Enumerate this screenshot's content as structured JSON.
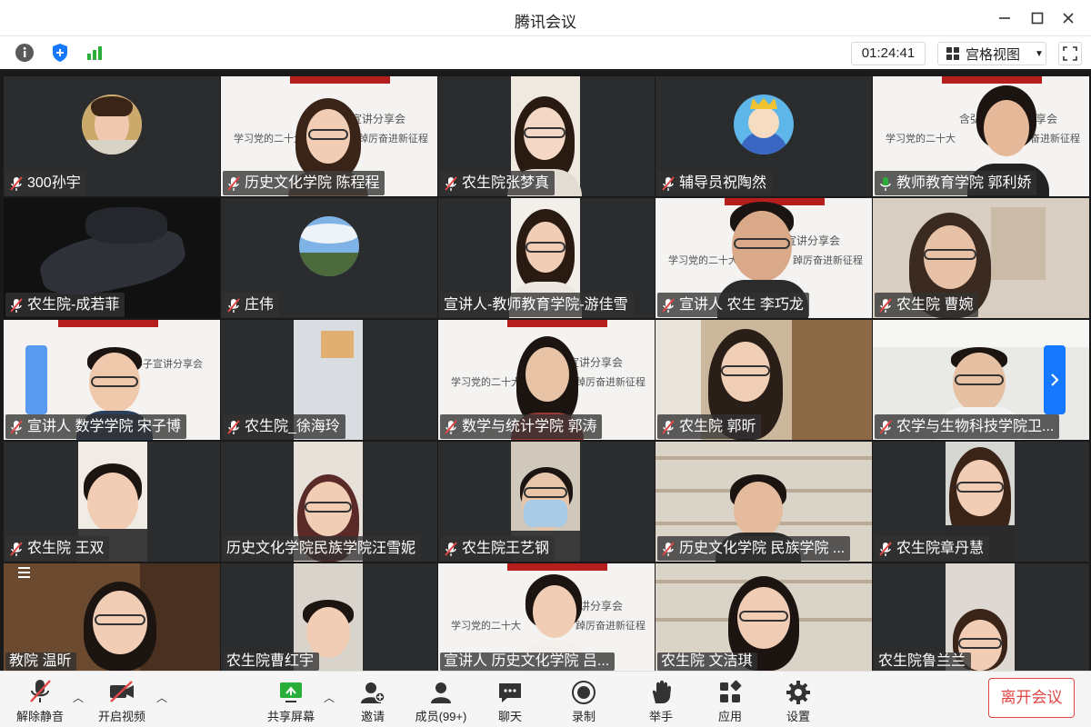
{
  "window": {
    "title": "腾讯会议"
  },
  "toolbar": {
    "timer": "01:24:41",
    "view_mode": "宫格视图"
  },
  "participants": [
    "300孙宇",
    "历史文化学院 陈程程",
    "农生院张梦真",
    "辅导员祝陶然",
    "教师教育学院 郭利娇",
    "农生院-成若菲",
    "庄伟",
    "宣讲人-教师教育学院-游佳雪",
    "宣讲人 农生 李巧龙",
    "农生院 曹婉",
    "宣讲人 数学学院 宋子博",
    "农生院_徐海玲",
    "数学与统计学院 郭涛",
    "农生院 郭昕",
    "农学与生物科技学院卫...",
    "农生院 王双",
    "历史文化学院民族学院汪雪妮",
    "农生院王艺钢",
    "历史文化学院 民族学院 ...",
    "农生院章丹慧",
    "教院 温昕",
    "农生院曹红宇",
    "宣讲人 历史文化学院 吕...",
    "农生院 文洁琪",
    "农生院鲁兰兰"
  ],
  "slide": {
    "title": "含弘学子宣讲分享会",
    "left_line": "学习党的二十大",
    "right_line": "踔厉奋进新征程"
  },
  "bottom": {
    "unmute": "解除静音",
    "start_video": "开启视频",
    "share_screen": "共享屏幕",
    "invite": "邀请",
    "members": "成员(99+)",
    "chat": "聊天",
    "record": "录制",
    "raise_hand": "举手",
    "apps": "应用",
    "settings": "设置",
    "leave": "离开会议"
  },
  "colors": {
    "leave_red": "#e04646",
    "slide_red": "#b61e1e",
    "accent_blue": "#1677ff"
  }
}
